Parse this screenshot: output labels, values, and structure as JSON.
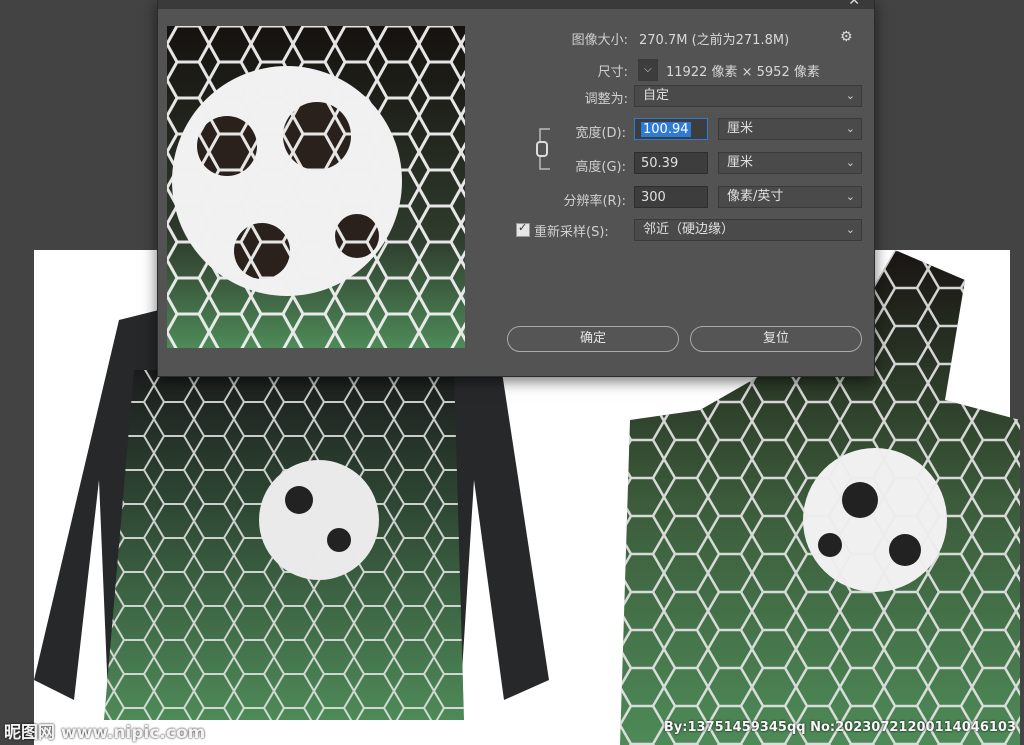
{
  "dialog": {
    "image_size_label": "图像大小:",
    "image_size_value": "270.7M (之前为271.8M)",
    "dimensions_label": "尺寸:",
    "dimensions_value": "11922 像素 × 5952 像素",
    "fit_to_label": "调整为:",
    "fit_to_value": "自定",
    "width_label": "宽度(D):",
    "width_value": "100.94",
    "width_unit": "厘米",
    "height_label": "高度(G):",
    "height_value": "50.39",
    "height_unit": "厘米",
    "resolution_label": "分辨率(R):",
    "resolution_value": "300",
    "resolution_unit": "像素/英寸",
    "resample_label": "重新采样(S):",
    "resample_checked": true,
    "resample_value": "邻近（硬边缘）",
    "ok_label": "确定",
    "reset_label": "复位",
    "close_glyph": "✕"
  },
  "footer": {
    "watermark": "昵图网 www.nipic.com",
    "credit": "By:13751459345qq No:20230721200114046103"
  },
  "colors": {
    "accent": "#2d7bd6",
    "dialog_bg": "#535353",
    "net_green": "#4e8a58"
  }
}
